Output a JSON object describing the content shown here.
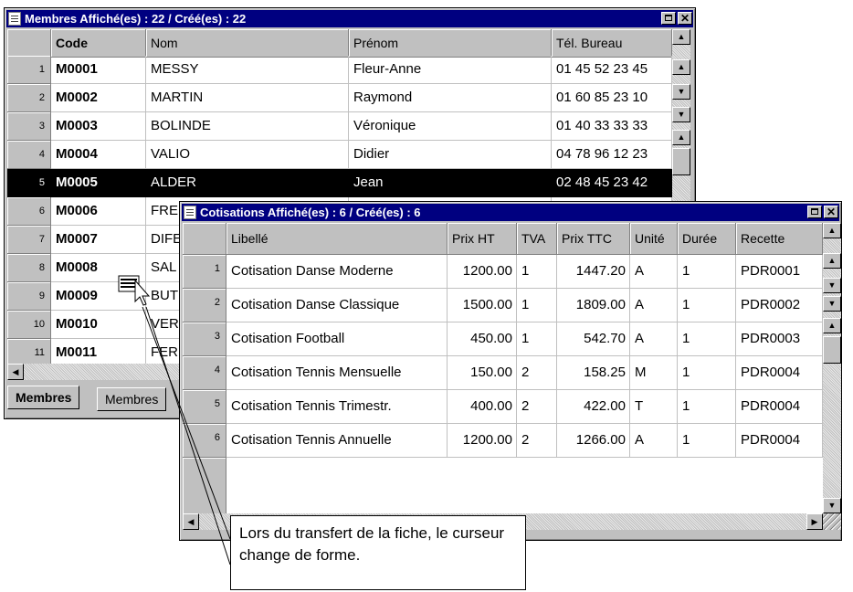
{
  "membres": {
    "title": "Membres Affiché(es) : 22 / Créé(es) : 22",
    "columns": [
      "Code",
      "Nom",
      "Prénom",
      "Tél. Bureau"
    ],
    "rows": [
      {
        "n": "1",
        "code": "M0001",
        "nom": "MESSY",
        "prenom": "Fleur-Anne",
        "tel": "01 45 52 23 45"
      },
      {
        "n": "2",
        "code": "M0002",
        "nom": "MARTIN",
        "prenom": "Raymond",
        "tel": "01 60 85 23 10"
      },
      {
        "n": "3",
        "code": "M0003",
        "nom": "BOLINDE",
        "prenom": "Véronique",
        "tel": "01 40 33 33 33"
      },
      {
        "n": "4",
        "code": "M0004",
        "nom": "VALIO",
        "prenom": "Didier",
        "tel": "04 78 96 12 23"
      },
      {
        "n": "5",
        "code": "M0005",
        "nom": "ALDER",
        "prenom": "Jean",
        "tel": "02 48 45 23 42"
      },
      {
        "n": "6",
        "code": "M0006",
        "nom": "FRE",
        "prenom": "",
        "tel": ""
      },
      {
        "n": "7",
        "code": "M0007",
        "nom": "DIFE",
        "prenom": "",
        "tel": ""
      },
      {
        "n": "8",
        "code": "M0008",
        "nom": "SAL",
        "prenom": "",
        "tel": ""
      },
      {
        "n": "9",
        "code": "M0009",
        "nom": "BUT",
        "prenom": "",
        "tel": ""
      },
      {
        "n": "10",
        "code": "M0010",
        "nom": "VER",
        "prenom": "",
        "tel": ""
      },
      {
        "n": "11",
        "code": "M0011",
        "nom": "FER",
        "prenom": "",
        "tel": ""
      }
    ],
    "selected_row": 4,
    "tabs": [
      "Membres",
      "Membres"
    ]
  },
  "cotisations": {
    "title": "Cotisations Affiché(es) : 6 / Créé(es) : 6",
    "columns": [
      "Libellé",
      "Prix HT",
      "TVA",
      "Prix TTC",
      "Unité",
      "Durée",
      "Recette"
    ],
    "rows": [
      {
        "n": "1",
        "libelle": "Cotisation Danse Moderne",
        "ht": "1200.00",
        "tva": "1",
        "ttc": "1447.20",
        "unite": "A",
        "duree": "1",
        "recette": "PDR0001"
      },
      {
        "n": "2",
        "libelle": "Cotisation Danse Classique",
        "ht": "1500.00",
        "tva": "1",
        "ttc": "1809.00",
        "unite": "A",
        "duree": "1",
        "recette": "PDR0002"
      },
      {
        "n": "3",
        "libelle": "Cotisation Football",
        "ht": "450.00",
        "tva": "1",
        "ttc": "542.70",
        "unite": "A",
        "duree": "1",
        "recette": "PDR0003"
      },
      {
        "n": "4",
        "libelle": "Cotisation Tennis Mensuelle",
        "ht": "150.00",
        "tva": "2",
        "ttc": "158.25",
        "unite": "M",
        "duree": "1",
        "recette": "PDR0004"
      },
      {
        "n": "5",
        "libelle": "Cotisation Tennis Trimestr.",
        "ht": "400.00",
        "tva": "2",
        "ttc": "422.00",
        "unite": "T",
        "duree": "1",
        "recette": "PDR0004"
      },
      {
        "n": "6",
        "libelle": "Cotisation Tennis Annuelle",
        "ht": "1200.00",
        "tva": "2",
        "ttc": "1266.00",
        "unite": "A",
        "duree": "1",
        "recette": "PDR0004"
      }
    ]
  },
  "callout": {
    "text": "Lors du transfert de la fiche, le curseur change de forme."
  },
  "colors": {
    "titlebar": "#000080",
    "selection": "#000000",
    "chrome": "#c0c0c0"
  }
}
